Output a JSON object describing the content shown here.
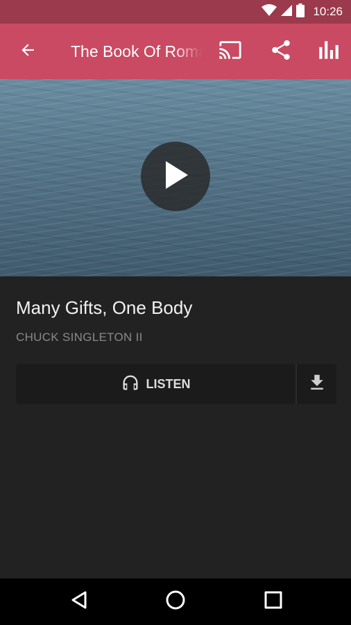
{
  "status_bar": {
    "time": "10:26",
    "icons": [
      "wifi-icon",
      "signal-icon",
      "battery-icon"
    ]
  },
  "app_bar": {
    "back_icon": "arrow-left-icon",
    "title": "The Book Of Romans",
    "actions": [
      "cast-icon",
      "share-icon",
      "equalizer-icon"
    ],
    "color": "#c94a62"
  },
  "hero": {
    "play_icon": "play-icon"
  },
  "sermon": {
    "title": "Many Gifts, One Body",
    "speaker": "CHUCK SINGLETON II"
  },
  "actions": {
    "listen_label": "LISTEN",
    "listen_icon": "headphones-icon",
    "download_icon": "download-icon"
  },
  "nav_bar": {
    "buttons": [
      "back-triangle-icon",
      "home-circle-icon",
      "recents-square-icon"
    ]
  }
}
